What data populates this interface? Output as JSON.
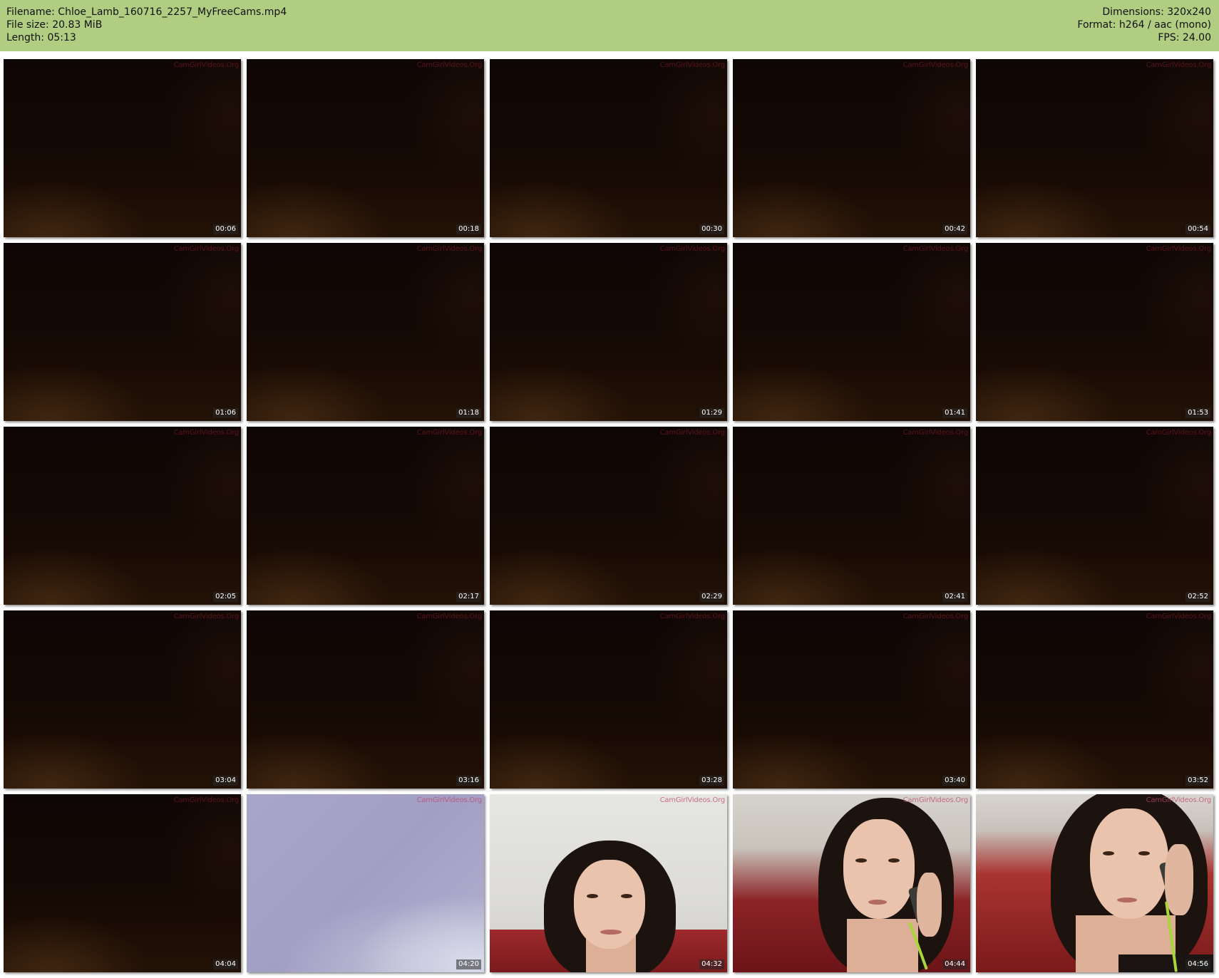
{
  "header": {
    "filename": "Filename: Chloe_Lamb_160716_2257_MyFreeCams.mp4",
    "filesize": "File size: 20.83 MiB",
    "length": "Length: 05:13",
    "dimensions": "Dimensions: 320x240",
    "format": "Format: h264 / aac (mono)",
    "fps": "FPS: 24.00",
    "bar_color": "#b1cd82"
  },
  "thumbnails": [
    {
      "time": "00:06",
      "scene": "dark"
    },
    {
      "time": "00:18",
      "scene": "dark"
    },
    {
      "time": "00:30",
      "scene": "dark"
    },
    {
      "time": "00:42",
      "scene": "dark"
    },
    {
      "time": "00:54",
      "scene": "dark"
    },
    {
      "time": "01:06",
      "scene": "dark"
    },
    {
      "time": "01:18",
      "scene": "dark"
    },
    {
      "time": "01:29",
      "scene": "dark"
    },
    {
      "time": "01:41",
      "scene": "dark"
    },
    {
      "time": "01:53",
      "scene": "dark"
    },
    {
      "time": "02:05",
      "scene": "dark"
    },
    {
      "time": "02:17",
      "scene": "dark"
    },
    {
      "time": "02:29",
      "scene": "dark"
    },
    {
      "time": "02:41",
      "scene": "dark"
    },
    {
      "time": "02:52",
      "scene": "dark"
    },
    {
      "time": "03:04",
      "scene": "dark"
    },
    {
      "time": "03:16",
      "scene": "dark"
    },
    {
      "time": "03:28",
      "scene": "dark"
    },
    {
      "time": "03:40",
      "scene": "dark"
    },
    {
      "time": "03:52",
      "scene": "dark"
    },
    {
      "time": "04:04",
      "scene": "dark"
    },
    {
      "time": "04:20",
      "scene": "lavender"
    },
    {
      "time": "04:32",
      "scene": "person"
    },
    {
      "time": "04:44",
      "scene": "person-phone"
    },
    {
      "time": "04:56",
      "scene": "person-phone-close"
    }
  ],
  "watermark": "CamGirlVideos.Org"
}
